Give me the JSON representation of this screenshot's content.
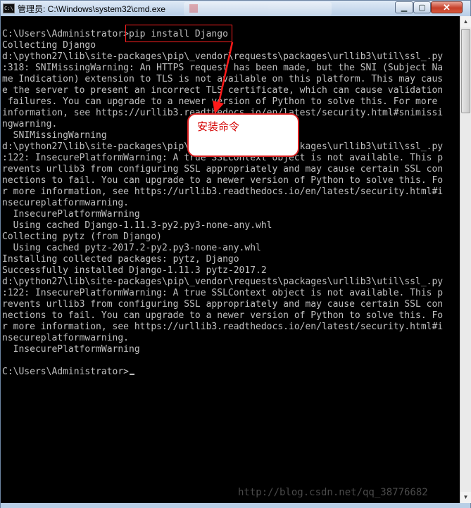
{
  "window": {
    "title": "管理员: C:\\Windows\\system32\\cmd.exe",
    "icon_text": "C:\\",
    "icon": "cmd-icon",
    "controls": {
      "minimize": "▁",
      "maximize": "▢",
      "close": "✕"
    }
  },
  "console": {
    "lines": [
      "C:\\Users\\Administrator>pip install Django",
      "Collecting Django",
      "d:\\python27\\lib\\site-packages\\pip\\_vendor\\requests\\packages\\urllib3\\util\\ssl_.py",
      ":318: SNIMissingWarning: An HTTPS request has been made, but the SNI (Subject Na",
      "me Indication) extension to TLS is not available on this platform. This may caus",
      "e the server to present an incorrect TLS certificate, which can cause validation",
      " failures. You can upgrade to a newer version of Python to solve this. For more",
      "information, see https://urllib3.readthedocs.io/en/latest/security.html#snimissi",
      "ngwarning.",
      "  SNIMissingWarning",
      "d:\\python27\\lib\\site-packages\\pip\\_vendor\\requests\\packages\\urllib3\\util\\ssl_.py",
      ":122: InsecurePlatformWarning: A true SSLContext object is not available. This p",
      "revents urllib3 from configuring SSL appropriately and may cause certain SSL con",
      "nections to fail. You can upgrade to a newer version of Python to solve this. Fo",
      "r more information, see https://urllib3.readthedocs.io/en/latest/security.html#i",
      "nsecureplatformwarning.",
      "  InsecurePlatformWarning",
      "  Using cached Django-1.11.3-py2.py3-none-any.whl",
      "Collecting pytz (from Django)",
      "  Using cached pytz-2017.2-py2.py3-none-any.whl",
      "Installing collected packages: pytz, Django",
      "Successfully installed Django-1.11.3 pytz-2017.2",
      "d:\\python27\\lib\\site-packages\\pip\\_vendor\\requests\\packages\\urllib3\\util\\ssl_.py",
      ":122: InsecurePlatformWarning: A true SSLContext object is not available. This p",
      "revents urllib3 from configuring SSL appropriately and may cause certain SSL con",
      "nections to fail. You can upgrade to a newer version of Python to solve this. Fo",
      "r more information, see https://urllib3.readthedocs.io/en/latest/security.html#i",
      "nsecureplatformwarning.",
      "  InsecurePlatformWarning",
      "",
      "C:\\Users\\Administrator>"
    ],
    "text_color": "#c0c0c0",
    "background": "#000000"
  },
  "annotation": {
    "callout_text": "安装命令",
    "color": "#ff0000"
  },
  "watermark": "http://blog.csdn.net/qq_38776682"
}
